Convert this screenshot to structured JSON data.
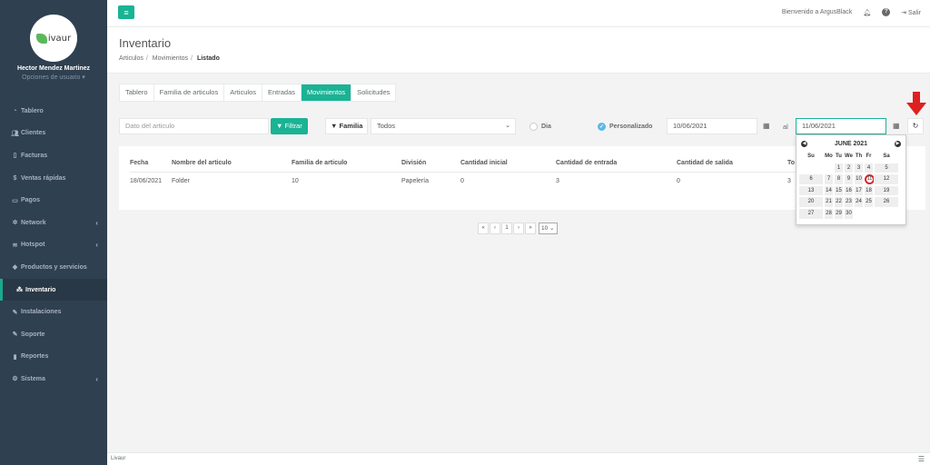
{
  "colors": {
    "accent": "#1ab394",
    "sidebar": "#2f4050",
    "arrow": "#e02020"
  },
  "sidebar": {
    "logo_text": "ivaur",
    "user_name": "Hector Mendez Martinez",
    "user_options": "Opciones de usuario ▾",
    "items": [
      {
        "label": "Tablero",
        "icon": "dashboard-icon"
      },
      {
        "label": "Clientes",
        "icon": "users-icon"
      },
      {
        "label": "Facturas",
        "icon": "file-icon"
      },
      {
        "label": "Ventas rápidas",
        "icon": "dollar-icon"
      },
      {
        "label": "Pagos",
        "icon": "money-icon"
      },
      {
        "label": "Network",
        "icon": "network-icon"
      },
      {
        "label": "Hotspot",
        "icon": "wifi-icon"
      },
      {
        "label": "Productos y servicios",
        "icon": "tag-icon"
      },
      {
        "label": "Inventario",
        "icon": "cubes-icon"
      },
      {
        "label": "Instalaciones",
        "icon": "wrench-icon"
      },
      {
        "label": "Soporte",
        "icon": "wrench-icon"
      },
      {
        "label": "Reportes",
        "icon": "book-icon"
      },
      {
        "label": "Sistema",
        "icon": "cogs-icon"
      }
    ]
  },
  "topbar": {
    "welcome": "Bienvenido a ArgusBlack",
    "logout": "Salir"
  },
  "heading": {
    "title": "Inventario",
    "crumbs": [
      "Articulos",
      "Movimientos",
      "Listado"
    ]
  },
  "tabs": [
    "Tablero",
    "Familia de articulos",
    "Articulos",
    "Entradas",
    "Movimientos",
    "Solicitudes"
  ],
  "filters": {
    "article_placeholder": "Dato del articulo",
    "filter_button": "Filtrar",
    "family_label": "Familia",
    "family_value": "Todos",
    "radio_day": "Dia",
    "radio_custom": "Personalizado",
    "date_from": "10/06/2021",
    "al_label": "al",
    "date_to": "11/06/2021"
  },
  "table": {
    "headers": [
      "Fecha",
      "Nombre del articulo",
      "Familia de articulo",
      "División",
      "Cantidad inicial",
      "Cantidad de entrada",
      "Cantidad de salida",
      "To"
    ],
    "rows": [
      [
        "18/06/2021",
        "Folder",
        "10",
        "Papelería",
        "0",
        "3",
        "0",
        "3"
      ]
    ]
  },
  "pagination": {
    "first": "«",
    "prev": "‹",
    "page": "1",
    "next": "›",
    "last": "»",
    "per_page": "10"
  },
  "calendar": {
    "title": "JUNE 2021",
    "dow": [
      "Su",
      "Mo",
      "Tu",
      "We",
      "Th",
      "Fr",
      "Sa"
    ],
    "weeks": [
      [
        "",
        "",
        "1",
        "2",
        "3",
        "4",
        "5"
      ],
      [
        "6",
        "7",
        "8",
        "9",
        "10",
        "11",
        "12"
      ],
      [
        "13",
        "14",
        "15",
        "16",
        "17",
        "18",
        "19"
      ],
      [
        "20",
        "21",
        "22",
        "23",
        "24",
        "25",
        "26"
      ],
      [
        "27",
        "28",
        "29",
        "30",
        "",
        "",
        ""
      ]
    ],
    "selected": "11"
  },
  "footer": {
    "text": "Livaur"
  }
}
